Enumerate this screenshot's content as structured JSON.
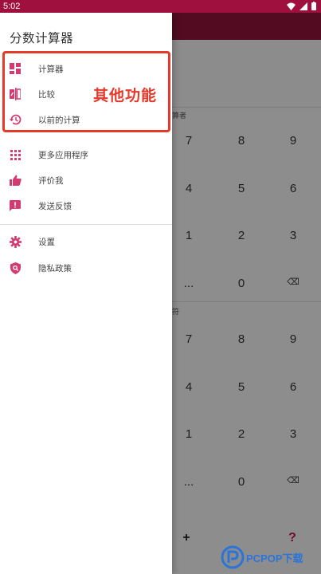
{
  "status_bar": {
    "time": "5:02"
  },
  "drawer": {
    "title": "分数计算器",
    "items": [
      {
        "label": "计算器",
        "icon": "dashboard-icon"
      },
      {
        "label": "比较",
        "icon": "compare-icon"
      },
      {
        "label": "以前的计算",
        "icon": "history-icon"
      },
      {
        "label": "更多应用程序",
        "icon": "apps-grid-icon"
      },
      {
        "label": "评价我",
        "icon": "thumb-up-icon"
      },
      {
        "label": "发送反馈",
        "icon": "feedback-icon"
      },
      {
        "label": "设置",
        "icon": "gear-icon"
      },
      {
        "label": "隐私政策",
        "icon": "shield-icon"
      }
    ]
  },
  "annotation": {
    "text": "其他功能",
    "color": "#e53a2a"
  },
  "background": {
    "section1_label": "算者",
    "section2_label": "符",
    "keypad1": [
      [
        "7",
        "8",
        "9"
      ],
      [
        "4",
        "5",
        "6"
      ],
      [
        "1",
        "2",
        "3"
      ],
      [
        "...",
        "0",
        "⌫"
      ]
    ],
    "keypad2": [
      [
        "7",
        "8",
        "9"
      ],
      [
        "4",
        "5",
        "6"
      ],
      [
        "1",
        "2",
        "3"
      ],
      [
        "...",
        "0",
        "⌫"
      ]
    ],
    "bottom_keys": [
      "+",
      "?"
    ]
  },
  "watermark": {
    "text": "PCPOP下载"
  },
  "colors": {
    "accent": "#c2185b",
    "statusbar": "#a0103f"
  }
}
